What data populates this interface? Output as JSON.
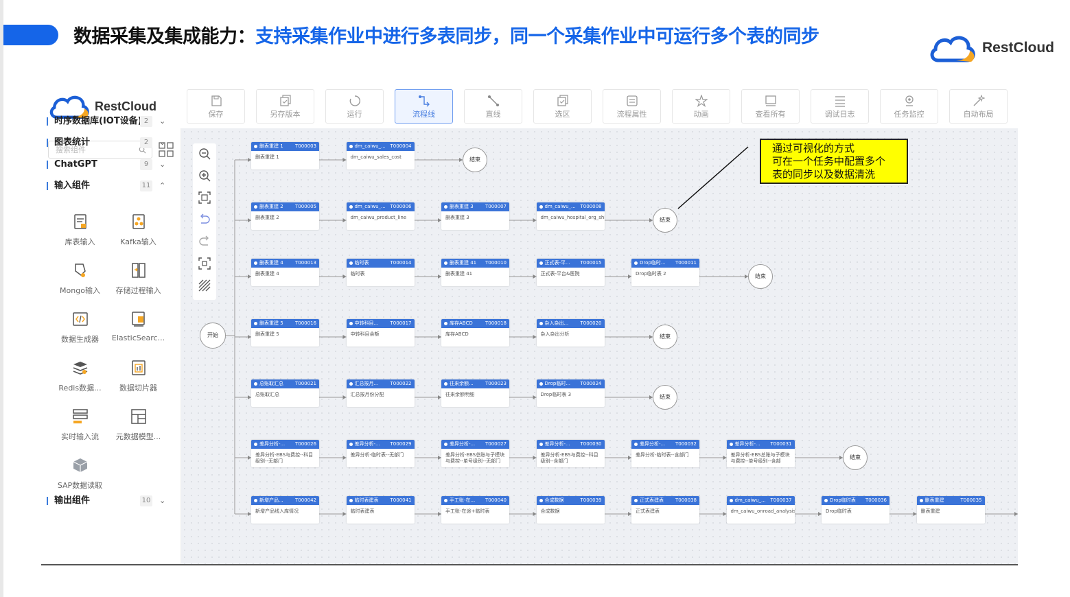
{
  "slide": {
    "title_lead": "数据采集及集成能力：",
    "title_highlight": "支持采集作业中进行多表同步，同一个采集作业中可运行多个表的同步",
    "brand": "RestCloud"
  },
  "app": {
    "brand": "RestCloud",
    "toolbar": [
      {
        "id": "save",
        "label": "保存",
        "icon": "save-icon"
      },
      {
        "id": "save-version",
        "label": "另存版本",
        "icon": "copy-icon"
      },
      {
        "id": "run",
        "label": "运行",
        "icon": "loading-icon"
      },
      {
        "id": "flow-line",
        "label": "流程线",
        "icon": "flow-line-icon",
        "active": true
      },
      {
        "id": "straight-line",
        "label": "直线",
        "icon": "straight-line-icon"
      },
      {
        "id": "select",
        "label": "选区",
        "icon": "select-area-icon"
      },
      {
        "id": "properties",
        "label": "流程属性",
        "icon": "properties-icon"
      },
      {
        "id": "animation",
        "label": "动画",
        "icon": "star-icon"
      },
      {
        "id": "view-all",
        "label": "查看所有",
        "icon": "view-all-icon"
      },
      {
        "id": "debug-log",
        "label": "调试日志",
        "icon": "list-icon"
      },
      {
        "id": "task-monitor",
        "label": "任务监控",
        "icon": "location-icon"
      },
      {
        "id": "auto-layout",
        "label": "自动布局",
        "icon": "magic-icon"
      }
    ],
    "sidebar": {
      "search_placeholder": "搜索组件",
      "categories": [
        {
          "label": "时序数据库(IOT设备)",
          "count": "2",
          "chev": "⌄"
        },
        {
          "label": "图表统计",
          "count": "2",
          "chev": "⌄"
        },
        {
          "label": "ChatGPT",
          "count": "9",
          "chev": "⌄"
        },
        {
          "label": "输入组件",
          "count": "11",
          "chev": "⌃"
        },
        {
          "label": "输出组件",
          "count": "10",
          "chev": "⌄"
        }
      ],
      "components": [
        {
          "label": "库表输入",
          "icon": "table-input-icon"
        },
        {
          "label": "Kafka输入",
          "icon": "kafka-input-icon"
        },
        {
          "label": "Mongo输入",
          "icon": "mongo-input-icon"
        },
        {
          "label": "存储过程输入",
          "icon": "procedure-input-icon"
        },
        {
          "label": "数据生成器",
          "icon": "data-generator-icon"
        },
        {
          "label": "ElasticSearc...",
          "icon": "elasticsearch-icon"
        },
        {
          "label": "Redis数据...",
          "icon": "redis-icon"
        },
        {
          "label": "数据切片器",
          "icon": "data-slicer-icon"
        },
        {
          "label": "实时输入流",
          "icon": "realtime-stream-icon"
        },
        {
          "label": "元数据模型...",
          "icon": "metadata-model-icon"
        },
        {
          "label": "SAP数据读取",
          "icon": "sap-icon"
        }
      ]
    },
    "canvas": {
      "start_label": "开始",
      "end_label": "结束",
      "rows": [
        {
          "nodes": [
            {
              "name": "删表重建 1",
              "code": "T000003",
              "desc": "删表重建 1"
            },
            {
              "name": "dm_caiwu_...",
              "code": "T000004",
              "desc": "dm_caiwu_sales_cost"
            }
          ]
        },
        {
          "nodes": [
            {
              "name": "删表重建 2",
              "code": "T000005",
              "desc": "删表重建 2"
            },
            {
              "name": "dm_caiwu_...",
              "code": "T000006",
              "desc": "dm_caiwu_product_line"
            },
            {
              "name": "删表重建 3",
              "code": "T000007",
              "desc": "删表重建 3"
            },
            {
              "name": "dm_caiwu_...",
              "code": "T000008",
              "desc": "dm_caiwu_hospital_org_ship"
            }
          ]
        },
        {
          "nodes": [
            {
              "name": "删表重建 4",
              "code": "T000013",
              "desc": "删表重建 4"
            },
            {
              "name": "临时表",
              "code": "T000014",
              "desc": "临时表"
            },
            {
              "name": "删表重建 41",
              "code": "T000010",
              "desc": "删表重建 41"
            },
            {
              "name": "正式表-平...",
              "code": "T000015",
              "desc": "正式表-平台&医院"
            },
            {
              "name": "Drop临时...",
              "code": "T000011",
              "desc": "Drop临时表 2"
            }
          ]
        },
        {
          "nodes": [
            {
              "name": "删表重建 5",
              "code": "T000016",
              "desc": "删表重建 5"
            },
            {
              "name": "中转科目...",
              "code": "T000017",
              "desc": "中转科目余额"
            },
            {
              "name": "库存ABCD",
              "code": "T000018",
              "desc": "库存ABCD"
            },
            {
              "name": "杂入杂出...",
              "code": "T000020",
              "desc": "杂入杂出分析"
            }
          ]
        },
        {
          "nodes": [
            {
              "name": "总账取汇总",
              "code": "T000021",
              "desc": "总账取汇总"
            },
            {
              "name": "汇总按月...",
              "code": "T000022",
              "desc": "汇总按月份分配"
            },
            {
              "name": "往来余额...",
              "code": "T000023",
              "desc": "往来余额明细"
            },
            {
              "name": "Drop临时...",
              "code": "T000024",
              "desc": "Drop临时表 3"
            }
          ]
        },
        {
          "nodes": [
            {
              "name": "差异分析-...",
              "code": "T000026",
              "desc": "差异分析-EBS与费控--科目级别--无部门"
            },
            {
              "name": "差异分析-...",
              "code": "T000029",
              "desc": "差异分析-临时表--无部门"
            },
            {
              "name": "差异分析-...",
              "code": "T000027",
              "desc": "差异分析-EBS总账与子模块与费控--单号级别--无部门"
            },
            {
              "name": "差异分析-...",
              "code": "T000030",
              "desc": "差异分析-EBS与费控--科目级别--含部门"
            },
            {
              "name": "差异分析-...",
              "code": "T000032",
              "desc": "差异分析-临时表--含部门"
            },
            {
              "name": "差异分析-...",
              "code": "T000031",
              "desc": "差异分析-EBS总账与子模块与费控--单号级别--含部"
            }
          ]
        },
        {
          "nodes": [
            {
              "name": "新增产品...",
              "code": "T000042",
              "desc": "新增产品线入库情况"
            },
            {
              "name": "临时表建表",
              "code": "T000041",
              "desc": "临时表建表"
            },
            {
              "name": "手工账-在...",
              "code": "T000040",
              "desc": "手工账-在途+临时表"
            },
            {
              "name": "合成数据",
              "code": "T000039",
              "desc": "合成数据"
            },
            {
              "name": "正式表建表",
              "code": "T000038",
              "desc": "正式表建表"
            },
            {
              "name": "dm_caiwu_...",
              "code": "T000037",
              "desc": "dm_caiwu_onroad_analysis"
            },
            {
              "name": "Drop临时表",
              "code": "T000036",
              "desc": "Drop临时表"
            },
            {
              "name": "删表重建",
              "code": "T000035",
              "desc": "删表重建"
            }
          ]
        }
      ]
    }
  },
  "annotation": {
    "lines": [
      "通过可视化的方式",
      "可在一个任务中配置多个",
      "表的同步以及数据清洗"
    ]
  }
}
